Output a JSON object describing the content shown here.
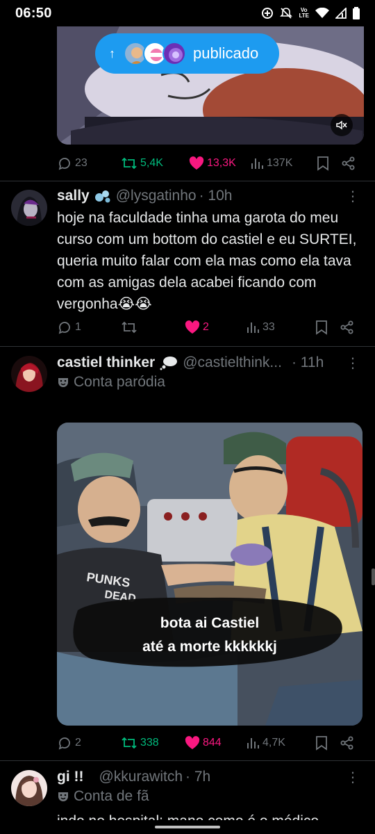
{
  "status_bar": {
    "time": "06:50",
    "volte_top": "Vo",
    "volte_bottom": "LTE"
  },
  "pill": {
    "text": "publicado",
    "arrow": "↑"
  },
  "post1": {
    "actions": {
      "replies": "23",
      "reposts": "5,4K",
      "likes": "13,3K",
      "views": "137K"
    }
  },
  "post2": {
    "name": "sally",
    "handle": "@lysgatinho",
    "time": "· 10h",
    "text": "hoje na faculdade tinha uma garota do meu curso com um bottom do castiel e eu SURTEI, queria muito falar com ela mas como ela tava com as amigas dela acabei ficando com vergonha😭😭",
    "actions": {
      "replies": "1",
      "reposts": "",
      "likes": "2",
      "views": "33"
    }
  },
  "post3": {
    "name": "castiel thinker",
    "handle": "@castielthink...",
    "time": "· 11h",
    "label": "Conta paródia",
    "caption_line1": "bota ai Castiel",
    "caption_line2": "até a morte kkkkkkj",
    "shirt_text1": "PUNKS",
    "shirt_text2": "DEAD",
    "actions": {
      "replies": "2",
      "reposts": "338",
      "likes": "844",
      "views": "4,7K"
    }
  },
  "post4": {
    "name": "gi !!",
    "handle": "@kkurawitch",
    "time": "· 7h",
    "label": "Conta de fã",
    "text": "indo no hospital: mano como é o médico"
  },
  "colors": {
    "accent": "#1d9bf0",
    "repost": "#00ba7c",
    "like": "#f91880",
    "muted": "#71767b"
  }
}
